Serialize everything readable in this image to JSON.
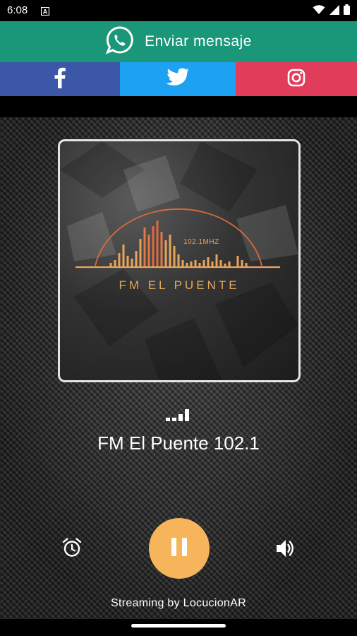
{
  "status_bar": {
    "time": "6:08",
    "notification_icon": "a-box-icon",
    "icons": [
      "wifi-icon",
      "signal-icon",
      "battery-icon"
    ]
  },
  "whatsapp": {
    "label": "Enviar mensaje",
    "icon": "whatsapp-icon",
    "color": "#1a9679"
  },
  "social": [
    {
      "name": "facebook",
      "icon": "facebook-icon",
      "color": "#3c57a7"
    },
    {
      "name": "twitter",
      "icon": "twitter-icon",
      "color": "#1da1f2"
    },
    {
      "name": "instagram",
      "icon": "instagram-icon",
      "color": "#e23c5b"
    }
  ],
  "cover": {
    "frequency": "102.1MHZ",
    "logo_text": "FM EL PUENTE"
  },
  "player": {
    "station_name": "FM El Puente 102.1",
    "state": "playing",
    "accent_color": "#f6b55a",
    "credits": "Streaming by LocucionAR"
  }
}
